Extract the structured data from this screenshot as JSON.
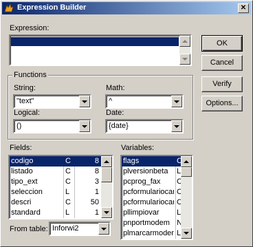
{
  "window": {
    "title": "Expression Builder",
    "close_glyph": "✕"
  },
  "expression": {
    "label": "Expression:",
    "value": ""
  },
  "buttons": {
    "ok": "OK",
    "cancel": "Cancel",
    "verify": "Verify",
    "options": "Options..."
  },
  "functions": {
    "group_label": "Functions",
    "string": {
      "label": "String:",
      "value": "\"text\""
    },
    "math": {
      "label": "Math:",
      "value": "^"
    },
    "logical": {
      "label": "Logical:",
      "value": "()"
    },
    "date": {
      "label": "Date:",
      "value": "{date}"
    }
  },
  "fields": {
    "label": "Fields:",
    "rows": [
      {
        "name": "codigo",
        "type": "C",
        "size": "8",
        "selected": true
      },
      {
        "name": "listado",
        "type": "C",
        "size": "8",
        "selected": false
      },
      {
        "name": "tipo_ext",
        "type": "C",
        "size": "3",
        "selected": false
      },
      {
        "name": "seleccion",
        "type": "L",
        "size": "1",
        "selected": false
      },
      {
        "name": "descri",
        "type": "C",
        "size": "50",
        "selected": false
      },
      {
        "name": "standard",
        "type": "L",
        "size": "1",
        "selected": false
      }
    ]
  },
  "variables": {
    "label": "Variables:",
    "rows": [
      {
        "name": "flags",
        "type": "C",
        "selected": true
      },
      {
        "name": "plversionbeta",
        "type": "L",
        "selected": false
      },
      {
        "name": "pcprog_fax",
        "type": "C",
        "selected": false
      },
      {
        "name": "pcformulariocard",
        "type": "C",
        "selected": false
      },
      {
        "name": "pcformulariocard",
        "type": "C",
        "selected": false
      },
      {
        "name": "pllimpiovar",
        "type": "L",
        "selected": false
      },
      {
        "name": "pnportmodem",
        "type": "N",
        "selected": false
      },
      {
        "name": "plmarcarmodem",
        "type": "L",
        "selected": false
      }
    ]
  },
  "from_table": {
    "label": "From table:",
    "value": "Inforwi2"
  }
}
